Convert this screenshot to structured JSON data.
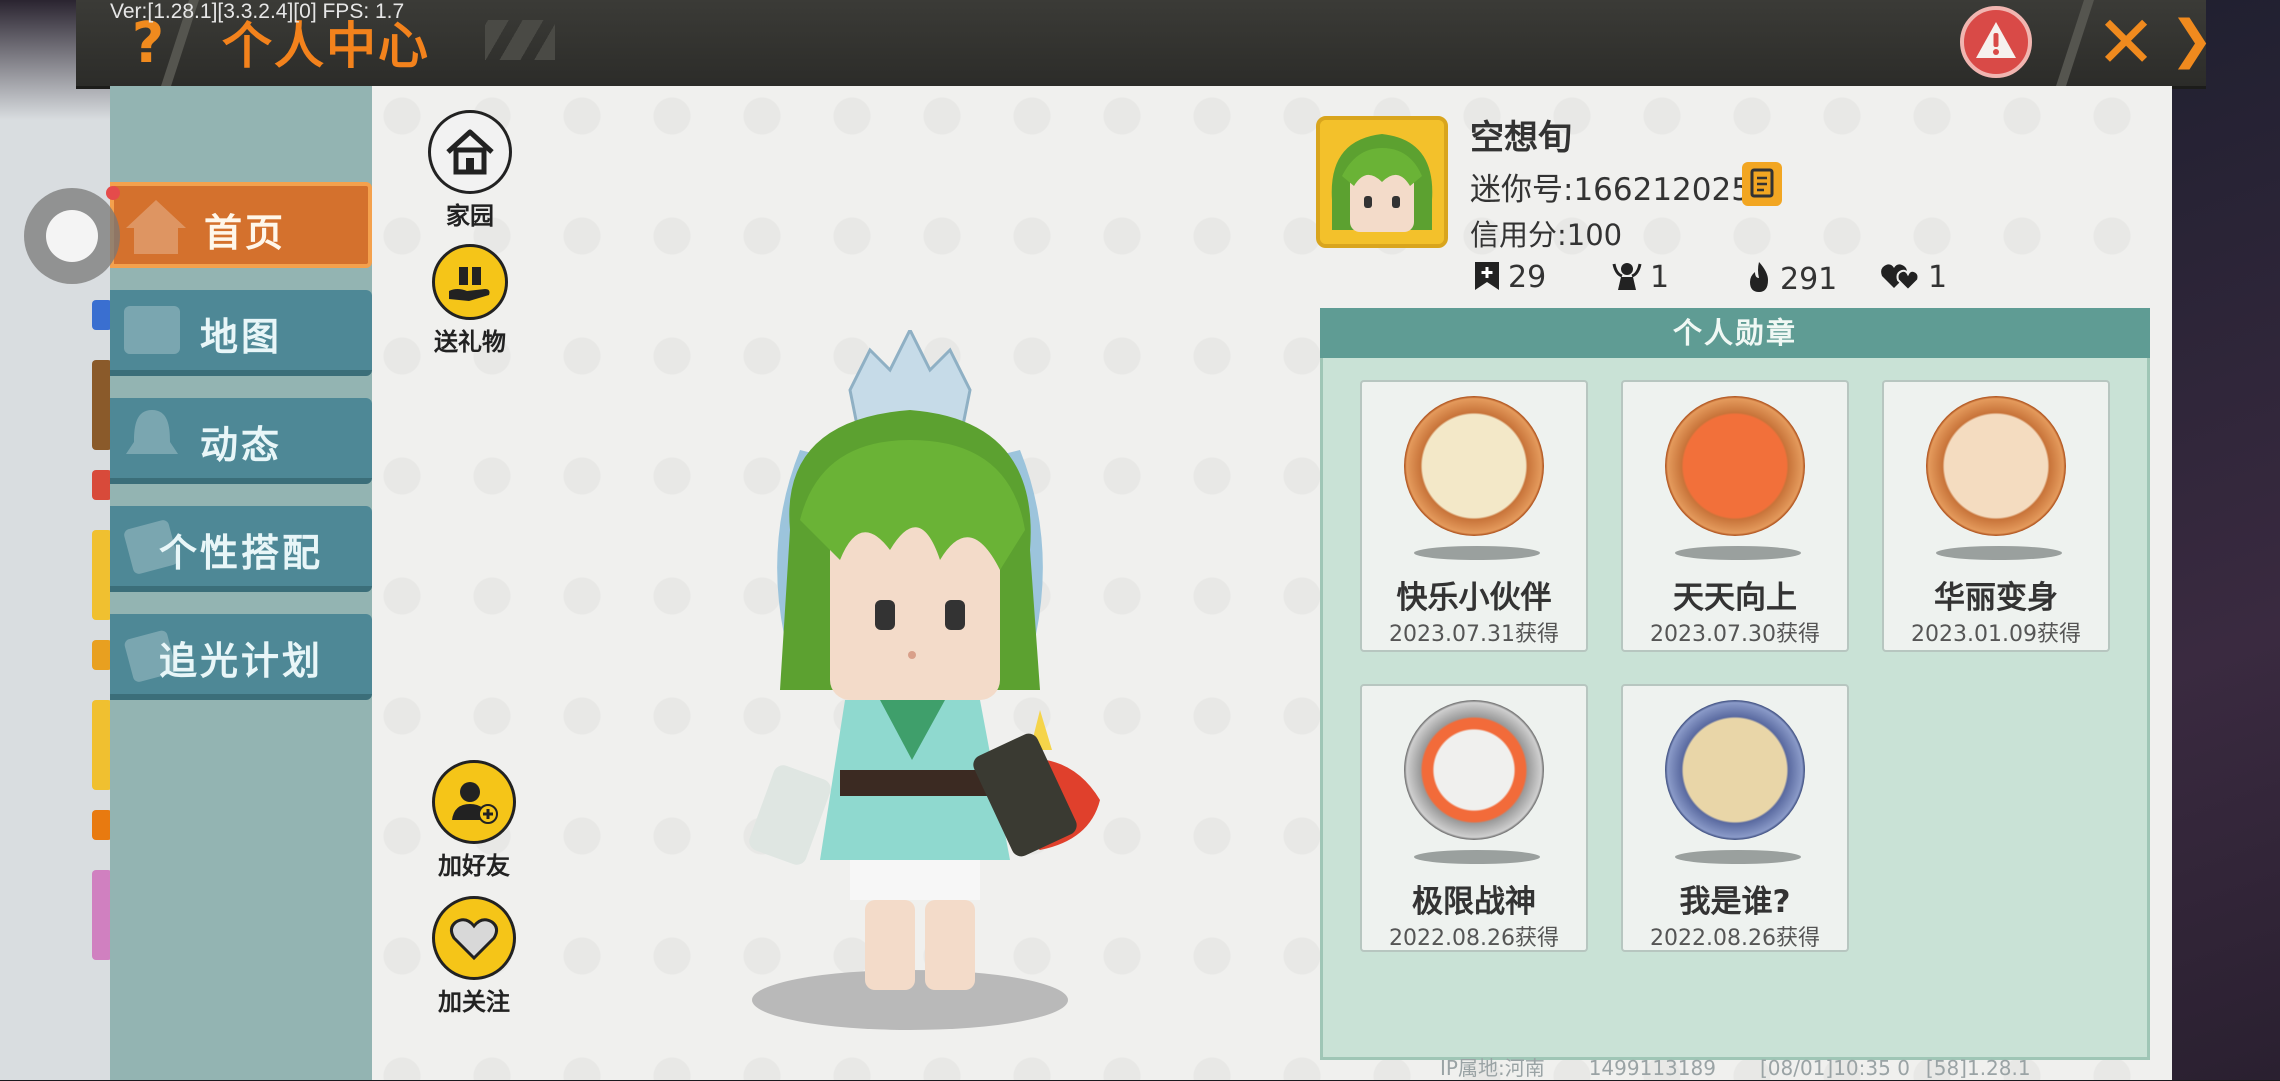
{
  "debug": {
    "version": "Ver:[1.28.1][3.3.2.4][0] FPS: 1.7"
  },
  "header": {
    "title": "个人中心",
    "help_glyph": "?",
    "close_glyph": "✕"
  },
  "sidebar": {
    "items": [
      {
        "label": "首页",
        "icon": "home-icon",
        "active": true
      },
      {
        "label": "地图",
        "icon": "map-icon",
        "active": false
      },
      {
        "label": "动态",
        "icon": "bell-icon",
        "active": false
      },
      {
        "label": "个性搭配",
        "icon": "outfit-icon",
        "active": false
      },
      {
        "label": "追光计划",
        "icon": "sparkle-icon",
        "active": false
      }
    ]
  },
  "actions": {
    "home": "家园",
    "gift": "送礼物",
    "add_friend": "加好友",
    "follow": "加关注"
  },
  "profile": {
    "nickname": "空想旬",
    "mini_id": "迷你号:1662120253",
    "credit": "信用分:100",
    "stats": [
      {
        "icon": "bookmark-plus-icon",
        "value": "29"
      },
      {
        "icon": "trophy-person-icon",
        "value": "1"
      },
      {
        "icon": "flame-icon",
        "value": "291"
      },
      {
        "icon": "hearts-icon",
        "value": "1"
      }
    ]
  },
  "medals": {
    "title": "个人勋章",
    "items": [
      {
        "name": "快乐小伙伴",
        "date": "2023.07.31获得"
      },
      {
        "name": "天天向上",
        "date": "2023.07.30获得"
      },
      {
        "name": "华丽变身",
        "date": "2023.01.09获得"
      },
      {
        "name": "极限战神",
        "date": "2022.08.26获得"
      },
      {
        "name": "我是谁?",
        "date": "2022.08.26获得"
      }
    ]
  },
  "footer": {
    "ip": "IP属地:河南",
    "uid": "1499113189",
    "time": "[08/01]10:35 0",
    "build": "[58]1.28.1"
  },
  "colors": {
    "accent_orange": "#f3821c",
    "sidebar_bg": "#93b4b2",
    "nav_inactive": "#4e8896",
    "medal_panel": "#c9e2d6",
    "medal_header": "#5f9c94"
  }
}
